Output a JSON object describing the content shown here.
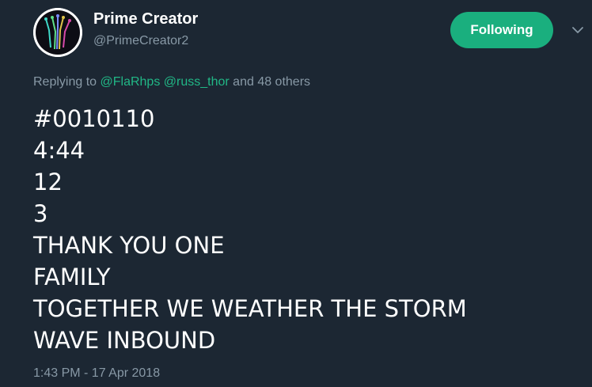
{
  "author": {
    "name": "Prime Creator",
    "handle": "@PrimeCreator2"
  },
  "follow_button": {
    "label": "Following",
    "color": "#1aaf7e"
  },
  "menu": {
    "icon": "chevron-down-icon"
  },
  "reply_context": {
    "prefix": "Replying to",
    "mentions": [
      "@FlaRhps",
      "@russ_thor"
    ],
    "suffix": "and 48 others"
  },
  "tweet_lines": [
    "#0010110",
    "4:44",
    "12",
    "3",
    "THANK YOU ONE",
    "FAMILY",
    "TOGETHER WE WEATHER THE STORM",
    "WAVE INBOUND"
  ],
  "timestamp": "1:43 PM - 17 Apr 2018",
  "colors": {
    "background": "#1c2733",
    "text": "#ffffff",
    "muted": "#8899a6",
    "mention": "#21b786"
  }
}
